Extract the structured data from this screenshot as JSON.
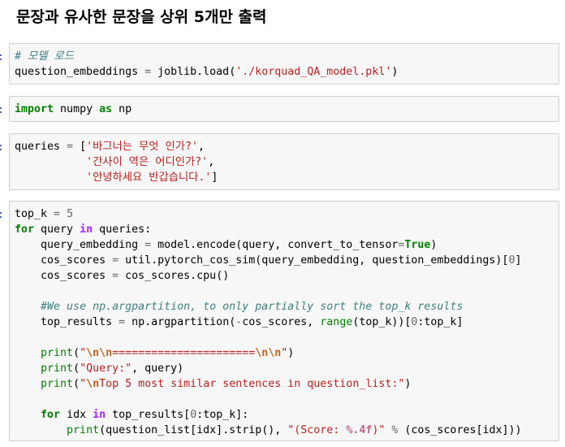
{
  "heading": "문장과 유사한 문장을 상위 5개만 출력",
  "cells": [
    {
      "prompt": ":",
      "lines": [
        [
          {
            "t": "# 모델 로드",
            "c": "comment"
          }
        ],
        [
          {
            "t": "question_embeddings "
          },
          {
            "t": "=",
            "c": "eq"
          },
          {
            "t": " joblib.load("
          },
          {
            "t": "'./korquad_QA_model.pkl'",
            "c": "str"
          },
          {
            "t": ")"
          }
        ]
      ]
    },
    {
      "prompt": ":",
      "lines": [
        [
          {
            "t": "import",
            "c": "kw"
          },
          {
            "t": " numpy "
          },
          {
            "t": "as",
            "c": "kw"
          },
          {
            "t": " np"
          }
        ]
      ]
    },
    {
      "prompt": ":",
      "lines": [
        [
          {
            "t": "queries "
          },
          {
            "t": "=",
            "c": "eq"
          },
          {
            "t": " ["
          },
          {
            "t": "'바그너는 무엇 인가?'",
            "c": "str"
          },
          {
            "t": ","
          }
        ],
        [
          {
            "t": "           "
          },
          {
            "t": "'간사이 역은 어디인가?'",
            "c": "str"
          },
          {
            "t": ","
          }
        ],
        [
          {
            "t": "           "
          },
          {
            "t": "'안녕하세요 반갑습니다.'",
            "c": "str"
          },
          {
            "t": "]"
          }
        ]
      ]
    },
    {
      "prompt": ":",
      "lines": [
        [
          {
            "t": "top_k "
          },
          {
            "t": "=",
            "c": "eq"
          },
          {
            "t": " "
          },
          {
            "t": "5",
            "c": "num"
          }
        ],
        [
          {
            "t": "for",
            "c": "kw"
          },
          {
            "t": " query "
          },
          {
            "t": "in",
            "c": "op"
          },
          {
            "t": " queries:"
          }
        ],
        [
          {
            "t": "    query_embedding "
          },
          {
            "t": "=",
            "c": "eq"
          },
          {
            "t": " model.encode(query, convert_to_tensor"
          },
          {
            "t": "=",
            "c": "eq"
          },
          {
            "t": "True",
            "c": "kw"
          },
          {
            "t": ")"
          }
        ],
        [
          {
            "t": "    cos_scores "
          },
          {
            "t": "=",
            "c": "eq"
          },
          {
            "t": " util.pytorch_cos_sim(query_embedding, question_embeddings)["
          },
          {
            "t": "0",
            "c": "num"
          },
          {
            "t": "]"
          }
        ],
        [
          {
            "t": "    cos_scores "
          },
          {
            "t": "=",
            "c": "eq"
          },
          {
            "t": " cos_scores.cpu()"
          }
        ],
        [],
        [
          {
            "t": "    "
          },
          {
            "t": "#We use np.argpartition, to only partially sort the top_k results",
            "c": "comment"
          }
        ],
        [
          {
            "t": "    top_results "
          },
          {
            "t": "=",
            "c": "eq"
          },
          {
            "t": " np.argpartition("
          },
          {
            "t": "-",
            "c": "eq"
          },
          {
            "t": "cos_scores, "
          },
          {
            "t": "range",
            "c": "builtin"
          },
          {
            "t": "(top_k))["
          },
          {
            "t": "0",
            "c": "num"
          },
          {
            "t": ":top_k]"
          }
        ],
        [],
        [
          {
            "t": "    "
          },
          {
            "t": "print",
            "c": "builtin"
          },
          {
            "t": "("
          },
          {
            "t": "\"",
            "c": "str"
          },
          {
            "t": "\\n\\n",
            "c": "esc"
          },
          {
            "t": "======================",
            "c": "str"
          },
          {
            "t": "\\n\\n",
            "c": "esc"
          },
          {
            "t": "\"",
            "c": "str"
          },
          {
            "t": ")"
          }
        ],
        [
          {
            "t": "    "
          },
          {
            "t": "print",
            "c": "builtin"
          },
          {
            "t": "("
          },
          {
            "t": "\"Query:\"",
            "c": "str"
          },
          {
            "t": ", query)"
          }
        ],
        [
          {
            "t": "    "
          },
          {
            "t": "print",
            "c": "builtin"
          },
          {
            "t": "("
          },
          {
            "t": "\"",
            "c": "str"
          },
          {
            "t": "\\n",
            "c": "esc"
          },
          {
            "t": "Top 5 most similar sentences in question_list:\"",
            "c": "str"
          },
          {
            "t": ")"
          }
        ],
        [],
        [
          {
            "t": "    "
          },
          {
            "t": "for",
            "c": "kw"
          },
          {
            "t": " idx "
          },
          {
            "t": "in",
            "c": "op"
          },
          {
            "t": " top_results["
          },
          {
            "t": "0",
            "c": "num"
          },
          {
            "t": ":top_k]:"
          }
        ],
        [
          {
            "t": "        "
          },
          {
            "t": "print",
            "c": "builtin"
          },
          {
            "t": "(question_list[idx].strip(), "
          },
          {
            "t": "\"(Score: ",
            "c": "str"
          },
          {
            "t": "%.4f",
            "c": "fmt"
          },
          {
            "t": ")\"",
            "c": "str"
          },
          {
            "t": " "
          },
          {
            "t": "%",
            "c": "eq"
          },
          {
            "t": " (cos_scores[idx]))"
          }
        ]
      ]
    }
  ]
}
